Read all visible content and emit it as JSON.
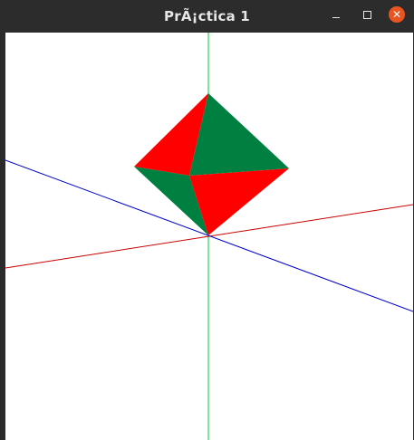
{
  "window": {
    "title": "PrÃ¡ctica 1",
    "controls": {
      "minimize_icon": "minimize-icon",
      "maximize_icon": "maximize-icon",
      "close_icon": "close-icon",
      "close_color": "#e95420"
    }
  },
  "scene": {
    "background": "#ffffff",
    "axes": [
      {
        "name": "x-axis",
        "color": "#ff0000"
      },
      {
        "name": "y-axis",
        "color": "#00ff00"
      },
      {
        "name": "z-axis",
        "color": "#0000ff"
      }
    ],
    "octahedron": {
      "face_colors": [
        "#ff0000",
        "#008040"
      ]
    }
  }
}
